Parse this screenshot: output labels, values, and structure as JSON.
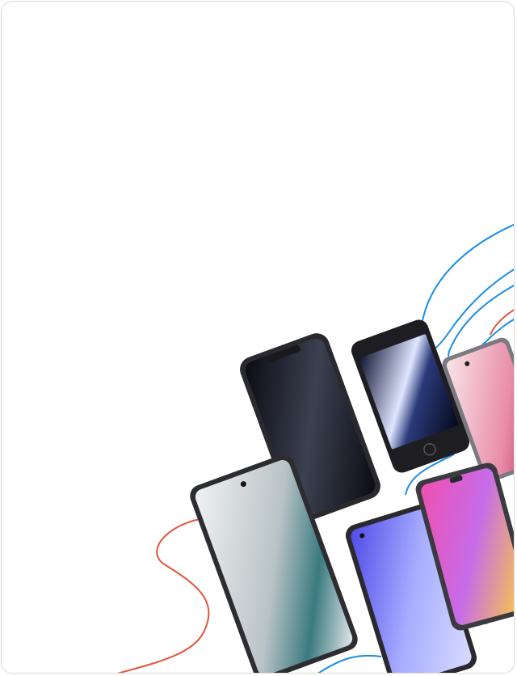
{
  "banner": {
    "background": "#ffffff",
    "border_color": "#d9d9d9",
    "cable_colors": {
      "blue": "#1a8fe3",
      "red": "#e2553f"
    },
    "phones": [
      {
        "name": "phone-dark-black-screen",
        "screen": [
          "#0a0a12",
          "#2b2f3a"
        ]
      },
      {
        "name": "phone-white-se-screen",
        "screen": [
          "#1a1f3b",
          "#c9d7ff"
        ]
      },
      {
        "name": "phone-pink-screen",
        "screen": [
          "#f5d5da",
          "#c62d6a"
        ]
      },
      {
        "name": "phone-gray-green-screen",
        "screen": [
          "#e4e8ea",
          "#1f5e66"
        ]
      },
      {
        "name": "phone-purple-screen",
        "screen": [
          "#6e6bf2",
          "#c3c7ff"
        ]
      },
      {
        "name": "phone-pink-yellow-screen",
        "screen": [
          "#e63c9f",
          "#ffd235"
        ]
      }
    ]
  }
}
